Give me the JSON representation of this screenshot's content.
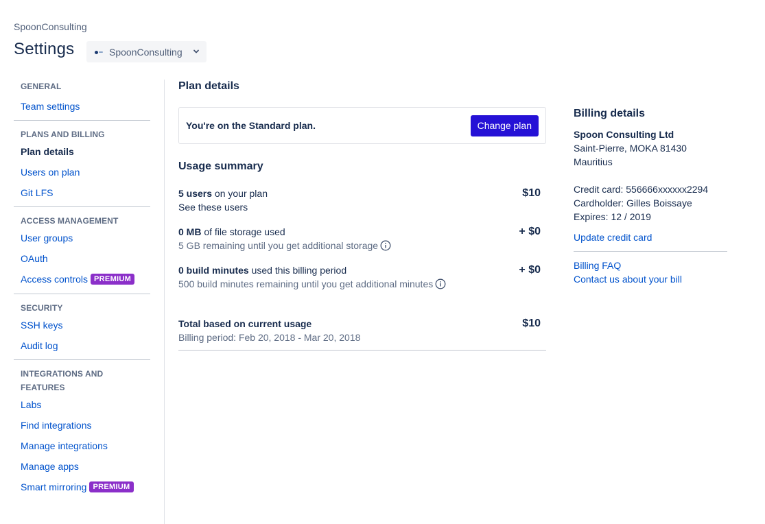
{
  "header": {
    "breadcrumb": "SpoonConsulting",
    "title": "Settings",
    "workspace_select": "SpoonConsulting"
  },
  "sidebar": {
    "sections": [
      {
        "heading": "GENERAL",
        "items": [
          {
            "label": "Team settings"
          }
        ]
      },
      {
        "heading": "PLANS AND BILLING",
        "items": [
          {
            "label": "Plan details",
            "active": true
          },
          {
            "label": "Users on plan"
          },
          {
            "label": "Git LFS"
          }
        ]
      },
      {
        "heading": "ACCESS MANAGEMENT",
        "items": [
          {
            "label": "User groups"
          },
          {
            "label": "OAuth"
          },
          {
            "label": "Access controls",
            "badge": "PREMIUM"
          }
        ]
      },
      {
        "heading": "SECURITY",
        "items": [
          {
            "label": "SSH keys"
          },
          {
            "label": "Audit log"
          }
        ]
      },
      {
        "heading": "INTEGRATIONS AND FEATURES",
        "items": [
          {
            "label": "Labs"
          },
          {
            "label": "Find integrations"
          },
          {
            "label": "Manage integrations"
          },
          {
            "label": "Manage apps"
          },
          {
            "label": "Smart mirroring",
            "badge": "PREMIUM"
          }
        ]
      }
    ]
  },
  "main": {
    "plan_title": "Plan details",
    "plan_text": "You're on the Standard plan.",
    "change_plan": "Change plan",
    "usage_title": "Usage summary",
    "usage": [
      {
        "bold": "5 users",
        "rest": " on your plan",
        "sub": "See these users",
        "price": "$10"
      },
      {
        "bold": "0 MB",
        "rest": " of file storage used",
        "sub": "5 GB remaining until you get additional storage",
        "price": "+ $0"
      },
      {
        "bold": "0 build minutes",
        "rest": " used this billing period",
        "sub": "500 build minutes remaining until you get additional minutes",
        "price": "+ $0"
      }
    ],
    "total_label": "Total based on current usage",
    "total_period": "Billing period: Feb 20, 2018 - Mar 20, 2018",
    "total_price": "$10"
  },
  "billing": {
    "title": "Billing details",
    "company": "Spoon Consulting Ltd",
    "address1": "Saint-Pierre, MOKA 81430",
    "address2": "Mauritius",
    "card_label": "Credit card:",
    "card_value": "556666xxxxxx2294",
    "holder_label": "Cardholder:",
    "holder_value": "Gilles Boissaye",
    "expires_label": "Expires:",
    "expires_value": "12 / 2019",
    "update_link": "Update credit card",
    "faq_link": "Billing FAQ",
    "contact_link": "Contact us about your bill"
  },
  "colors": {
    "primary_button": "#2511d6",
    "link": "#0052cc",
    "premium_badge": "#8b2fc9"
  }
}
